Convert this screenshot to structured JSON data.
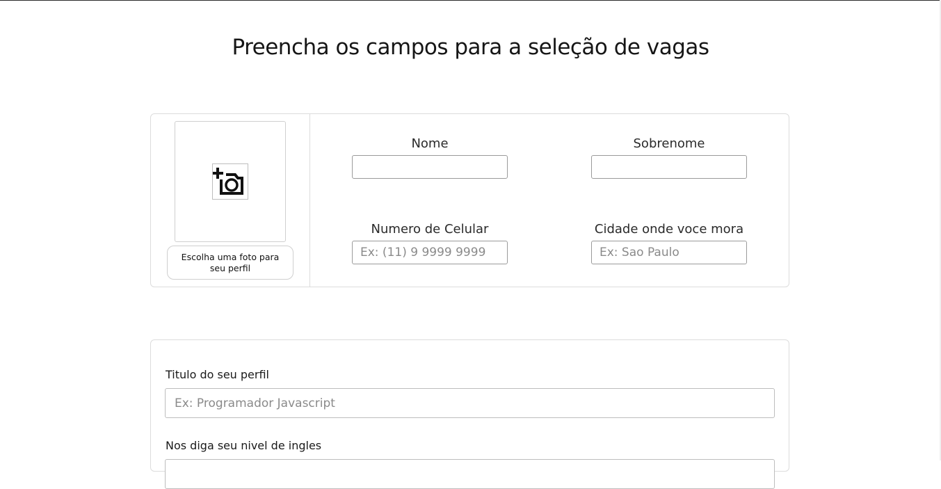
{
  "page": {
    "title": "Preencha os campos para a seleção de vagas"
  },
  "profile_photo": {
    "icon": "add-a-photo-icon",
    "button_label": "Escolha uma foto para seu perfil"
  },
  "fields": {
    "nome": {
      "label": "Nome",
      "value": "",
      "placeholder": ""
    },
    "sobrenome": {
      "label": "Sobrenome",
      "value": "",
      "placeholder": ""
    },
    "celular": {
      "label": "Numero de Celular",
      "value": "",
      "placeholder": "Ex: (11) 9 9999 9999"
    },
    "cidade": {
      "label": "Cidade onde voce mora",
      "value": "",
      "placeholder": "Ex: Sao Paulo"
    }
  },
  "profile": {
    "title_label": "Titulo do seu perfil",
    "title_placeholder": "Ex: Programador Javascript",
    "english_label": "Nos diga seu nivel de ingles",
    "english_value": ""
  }
}
